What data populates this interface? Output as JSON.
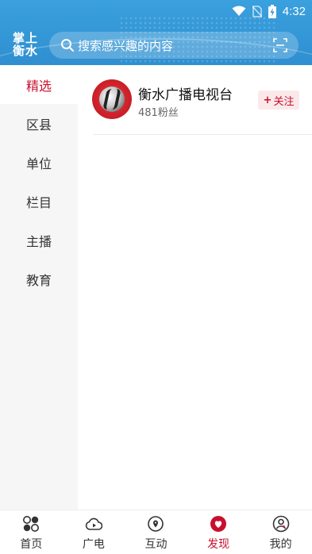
{
  "status_bar": {
    "time": "4:32"
  },
  "header": {
    "logo_text": "掌上\n衡水",
    "search_placeholder": "搜索感兴趣的内容"
  },
  "sidebar": {
    "items": [
      {
        "label": "精选",
        "active": true
      },
      {
        "label": "区县",
        "active": false
      },
      {
        "label": "单位",
        "active": false
      },
      {
        "label": "栏目",
        "active": false
      },
      {
        "label": "主播",
        "active": false
      },
      {
        "label": "教育",
        "active": false
      }
    ]
  },
  "feed": {
    "items": [
      {
        "name": "衡水广播电视台",
        "fans": "481粉丝",
        "follow_label": "关注",
        "follow_plus": "+"
      }
    ]
  },
  "tabbar": {
    "tabs": [
      {
        "label": "首页",
        "icon": "home-icon"
      },
      {
        "label": "广电",
        "icon": "broadcast-icon"
      },
      {
        "label": "互动",
        "icon": "interaction-icon"
      },
      {
        "label": "发现",
        "icon": "discover-icon",
        "active": true
      },
      {
        "label": "我的",
        "icon": "profile-icon"
      }
    ]
  },
  "colors": {
    "header_blue": "#3aa0de",
    "accent_red": "#c8102e"
  }
}
